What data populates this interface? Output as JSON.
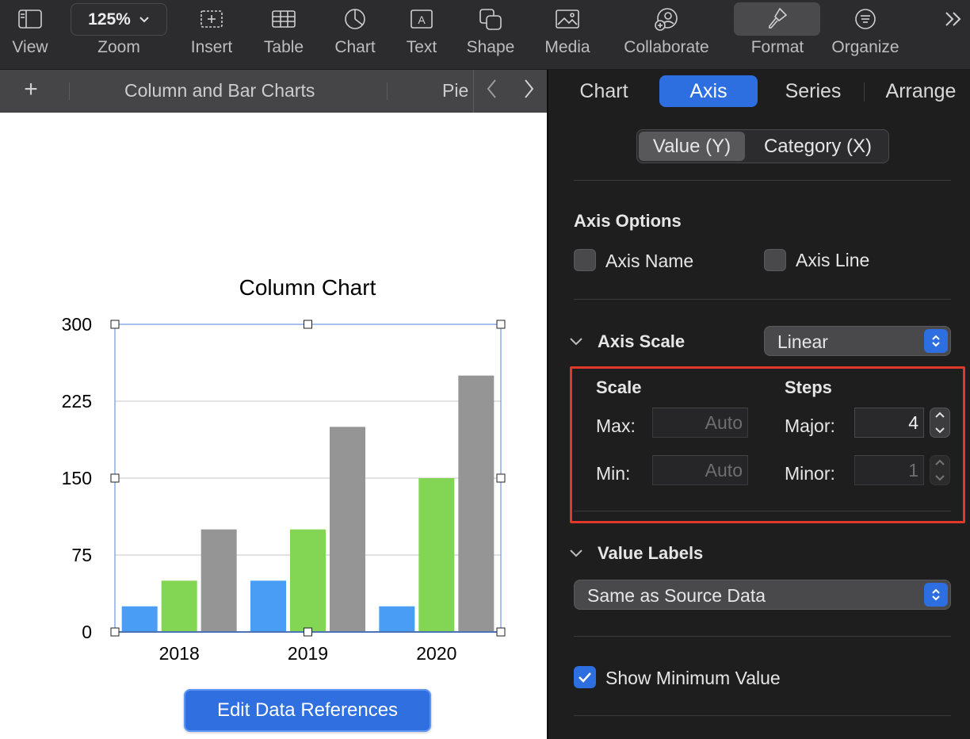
{
  "toolbar": {
    "view": "View",
    "zoom_value": "125%",
    "zoom": "Zoom",
    "insert": "Insert",
    "table": "Table",
    "chart": "Chart",
    "text": "Text",
    "shape": "Shape",
    "media": "Media",
    "collaborate": "Collaborate",
    "format": "Format",
    "organize": "Organize"
  },
  "sheet_tabs": {
    "tab1": "Column and Bar Charts",
    "tab2": "Pie"
  },
  "edit_button": "Edit Data References",
  "inspector": {
    "tabs": [
      "Chart",
      "Axis",
      "Series",
      "Arrange"
    ],
    "active_tab": "Axis",
    "segment": [
      "Value (Y)",
      "Category (X)"
    ],
    "axis_options": {
      "heading": "Axis Options",
      "axis_name": "Axis Name",
      "axis_line": "Axis Line"
    },
    "axis_scale": {
      "label": "Axis Scale",
      "value": "Linear"
    },
    "scale": {
      "heading": "Scale",
      "max_label": "Max:",
      "max_value": "Auto",
      "min_label": "Min:",
      "min_value": "Auto"
    },
    "steps": {
      "heading": "Steps",
      "major_label": "Major:",
      "major_value": "4",
      "minor_label": "Minor:",
      "minor_value": "1"
    },
    "value_labels": {
      "label": "Value Labels",
      "value": "Same as Source Data"
    },
    "show_minimum": "Show Minimum Value"
  },
  "chart_data": {
    "type": "bar",
    "title": "Column Chart",
    "categories": [
      "2018",
      "2019",
      "2020"
    ],
    "series": [
      {
        "color": "#4a9df5",
        "values": [
          25,
          50,
          25
        ]
      },
      {
        "color": "#82d653",
        "values": [
          50,
          100,
          150
        ]
      },
      {
        "color": "#959595",
        "values": [
          100,
          200,
          250
        ]
      }
    ],
    "ylim": [
      0,
      300
    ],
    "yticks": [
      0,
      75,
      150,
      225,
      300
    ],
    "grid": true
  }
}
